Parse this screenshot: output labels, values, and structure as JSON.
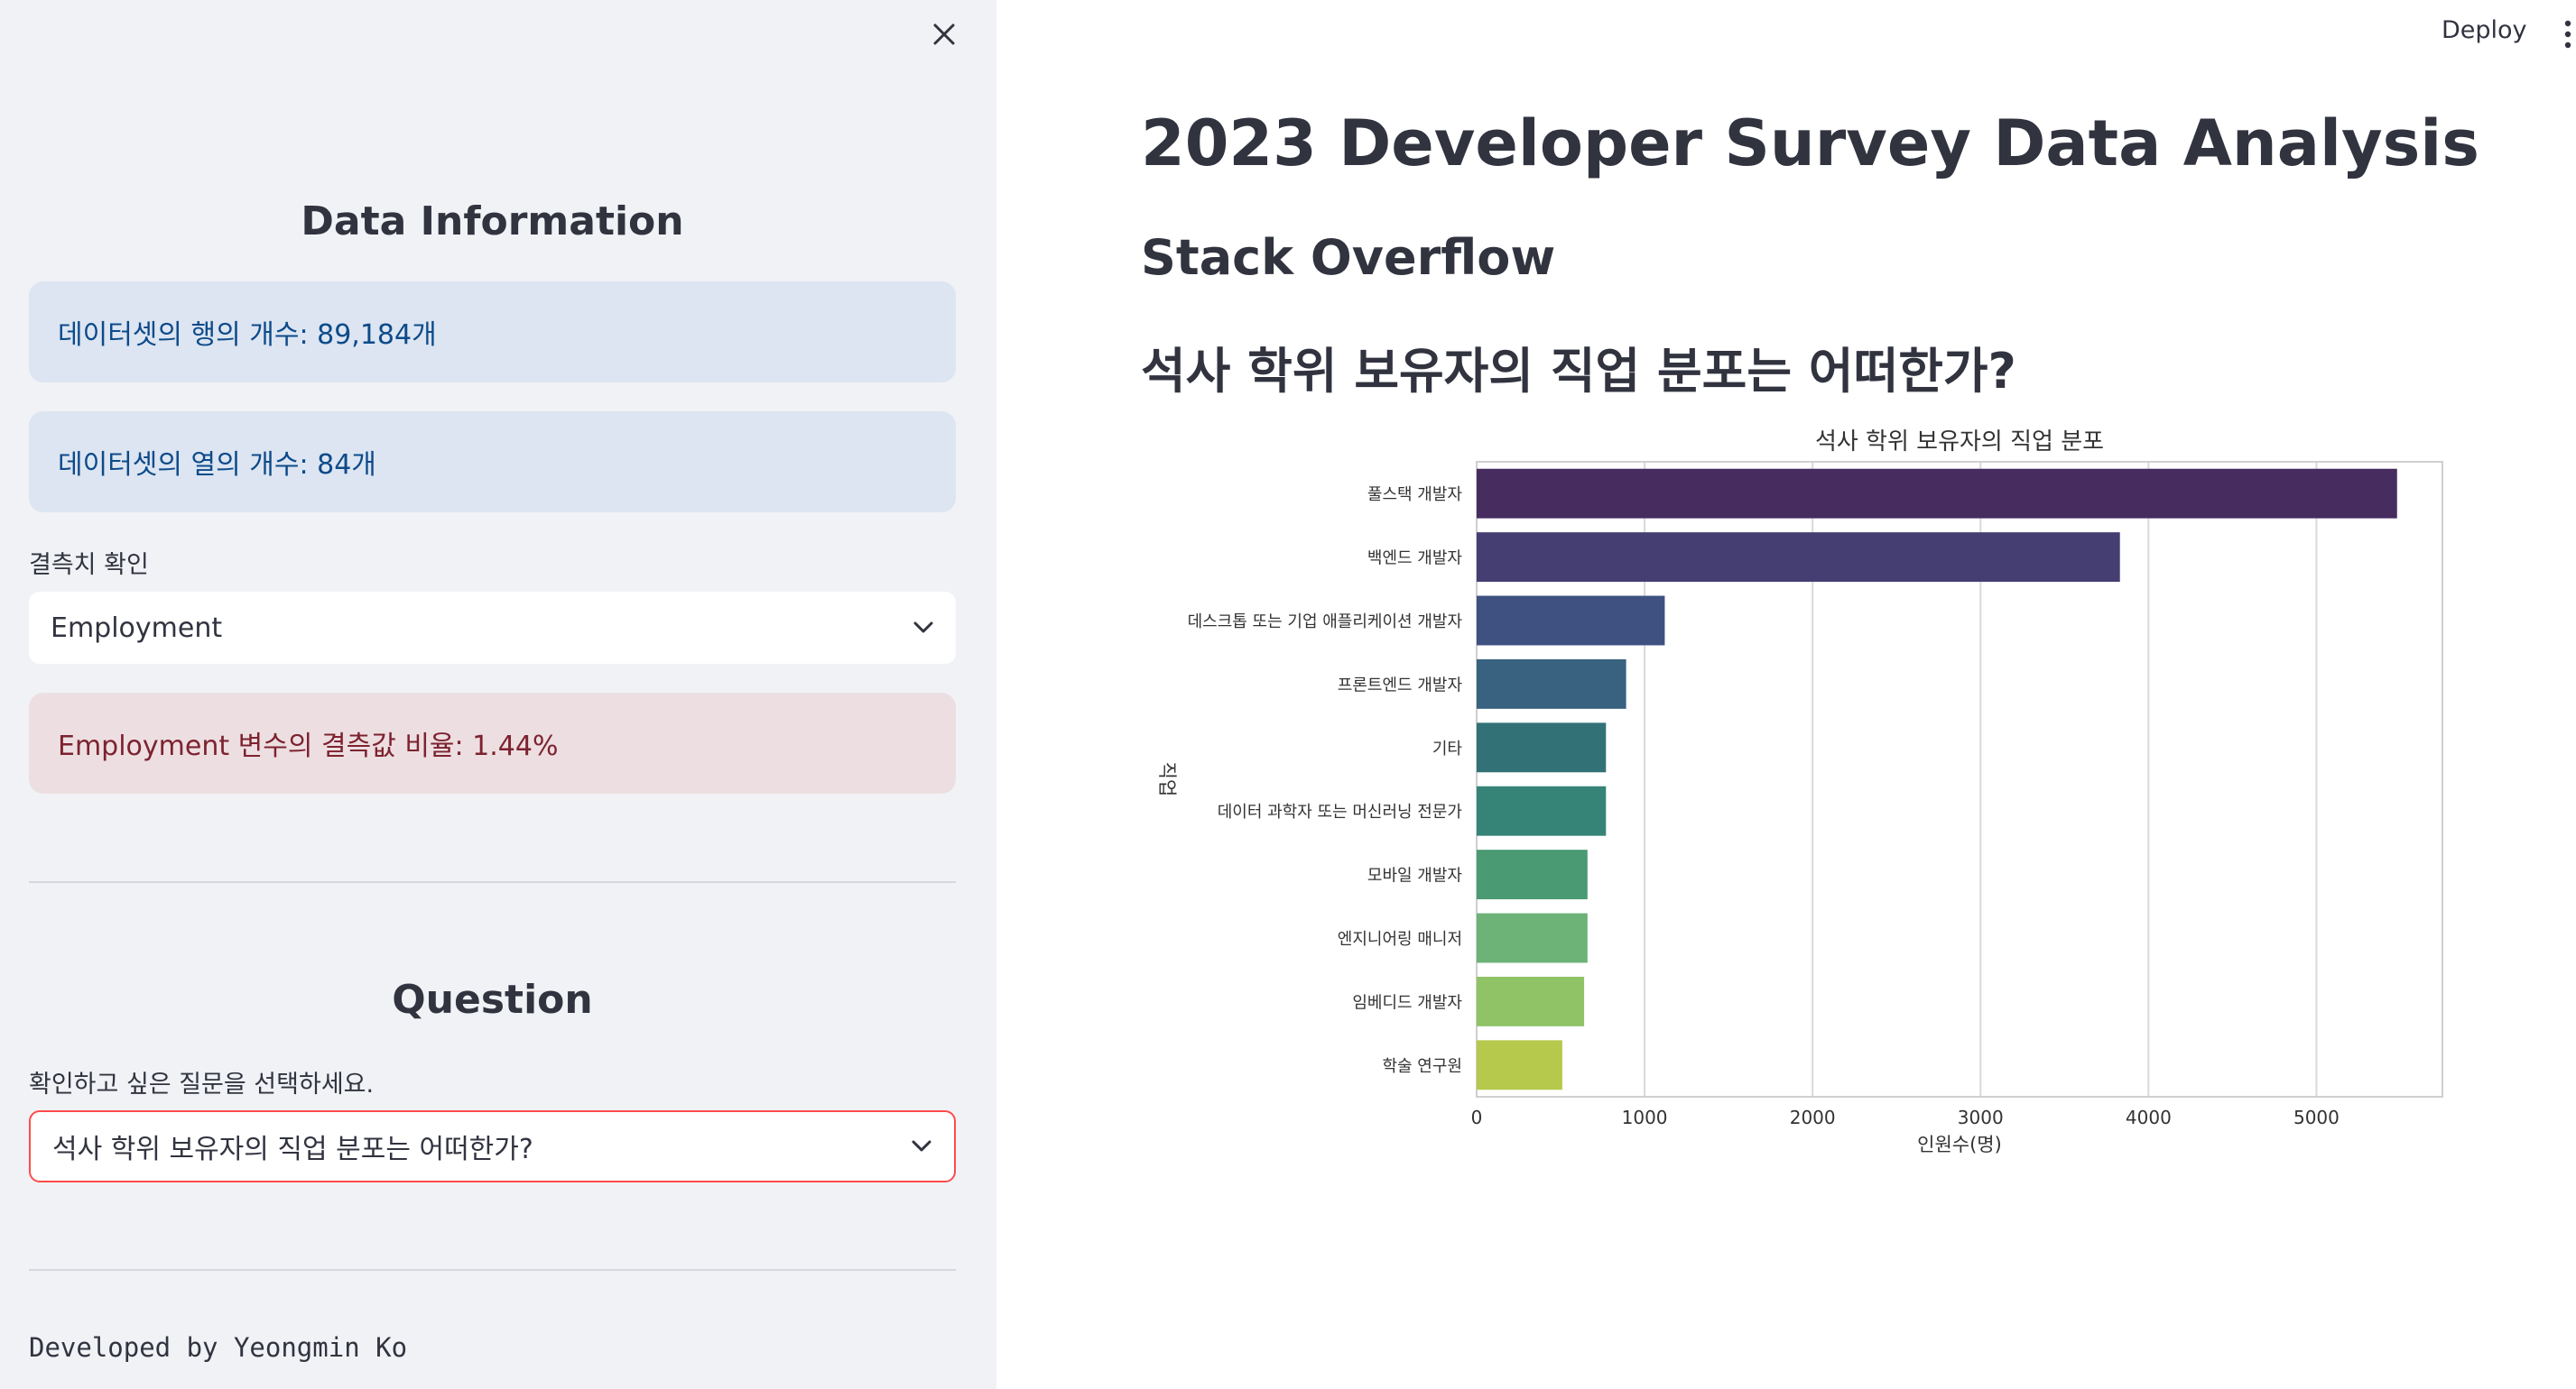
{
  "sidebar": {
    "data_info_title": "Data Information",
    "rows_info": "데이터셋의 행의 개수: 89,184개",
    "cols_info": "데이터셋의 열의 개수: 84개",
    "missing_label": "결측치 확인",
    "missing_select_value": "Employment",
    "missing_result": "Employment 변수의 결측값 비율: 1.44%",
    "question_title": "Question",
    "question_label": "확인하고 싶은 질문을 선택하세요.",
    "question_select_value": "석사 학위 보유자의 직업 분포는 어떠한가?",
    "footer": "Developed by Yeongmin Ko"
  },
  "header": {
    "deploy_label": "Deploy"
  },
  "main": {
    "title": "2023 Developer Survey Data Analysis",
    "subtitle": "Stack Overflow",
    "question_heading": "석사 학위 보유자의 직업 분포는 어떠한가?"
  },
  "chart_data": {
    "type": "bar",
    "orientation": "horizontal",
    "title": "석사 학위 보유자의 직업 분포",
    "xlabel": "인원수(명)",
    "ylabel": "직업",
    "categories": [
      "풀스택 개발자",
      "백엔드 개발자",
      "데스크톱 또는 기업 애플리케이션 개발자",
      "프론트엔드 개발자",
      "기타",
      "데이터 과학자 또는 머신러닝 전문가",
      "모바일 개발자",
      "엔지니어링 매니저",
      "임베디드 개발자",
      "학술 연구원"
    ],
    "values": [
      5480,
      3830,
      1120,
      890,
      770,
      770,
      660,
      660,
      640,
      510
    ],
    "colors": [
      "#472c60",
      "#443e73",
      "#3e5180",
      "#38627f",
      "#327277",
      "#368378",
      "#4a9a74",
      "#6db277",
      "#8fc366",
      "#b6c94c"
    ],
    "xlim": [
      0,
      5750
    ],
    "xticks": [
      0,
      1000,
      2000,
      3000,
      4000,
      5000
    ],
    "grid": true
  }
}
